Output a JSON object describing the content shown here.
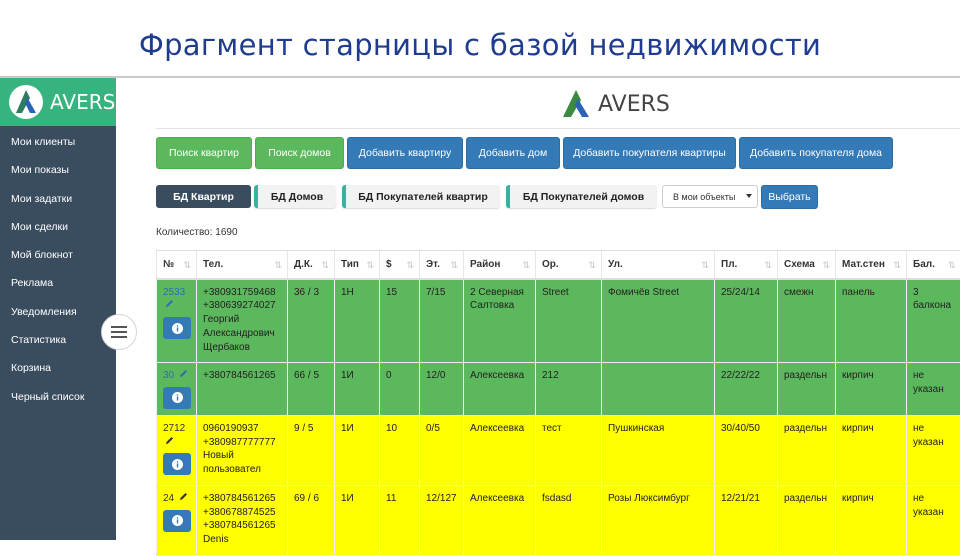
{
  "slide": {
    "title": "Фрагмент старницы с базой недвижимости"
  },
  "brand": {
    "logo_text": "AVERS"
  },
  "sidebar": {
    "items": [
      {
        "label": "Мои клиенты"
      },
      {
        "label": "Мои показы"
      },
      {
        "label": "Мои задатки"
      },
      {
        "label": "Мои сделки"
      },
      {
        "label": "Мой блокнот"
      },
      {
        "label": "Реклама"
      },
      {
        "label": "Уведомления"
      },
      {
        "label": "Статистика"
      },
      {
        "label": "Корзина"
      },
      {
        "label": "Черный список"
      }
    ]
  },
  "toolbar": {
    "buttons": [
      {
        "label": "Поиск квартир",
        "style": "green"
      },
      {
        "label": "Поиск домов",
        "style": "green"
      },
      {
        "label": "Добавить квартиру",
        "style": "blue"
      },
      {
        "label": "Добавить дом",
        "style": "blue"
      },
      {
        "label": "Добавить покупателя квартиры",
        "style": "blue"
      },
      {
        "label": "Добавить покупателя дома",
        "style": "blue"
      }
    ]
  },
  "tabs": [
    {
      "label": "БД Квартир",
      "active": true
    },
    {
      "label": "БД Домов",
      "active": false
    },
    {
      "label": "БД Покупателей квартир",
      "active": false
    },
    {
      "label": "БД Покупателей домов",
      "active": false
    }
  ],
  "filter": {
    "selected": "В мои объекты",
    "apply_label": "Выбрать"
  },
  "count_label": "Количество: 1690",
  "table": {
    "columns": [
      "№",
      "Тел.",
      "Д.К.",
      "Тип",
      "$",
      "Эт.",
      "Район",
      "Ор.",
      "Ул.",
      "Пл.",
      "Схема",
      "Мат.стен",
      "Бал."
    ],
    "rows": [
      {
        "color": "green",
        "id": "2533",
        "phones": "+380931759468 +380639274027 Георгий Александрович Щербаков",
        "dk": "36 / 3",
        "type": "1Н",
        "price": "15",
        "floor": "7/15",
        "district": "2 Северная Салтовка",
        "orient": "Street",
        "street": "Фомичёв Street",
        "area": "25/24/14",
        "scheme": "смежн",
        "walls": "панель",
        "balcony": "3 балкона"
      },
      {
        "color": "green",
        "id": "30",
        "phones": "+380784561265",
        "dk": "66 / 5",
        "type": "1И",
        "price": "0",
        "floor": "12/0",
        "district": "Алексеевка",
        "orient": "212",
        "street": "",
        "area": "22/22/22",
        "scheme": "раздельн",
        "walls": "кирпич",
        "balcony": "не указан"
      },
      {
        "color": "yellow",
        "id": "2712",
        "phones": "0960190937 +380987777777 Новый пользовател",
        "dk": "9 / 5",
        "type": "1И",
        "price": "10",
        "floor": "0/5",
        "district": "Алексеевка",
        "orient": "тест",
        "street": "Пушкинская",
        "area": "30/40/50",
        "scheme": "раздельн",
        "walls": "кирпич",
        "balcony": "не указан"
      },
      {
        "color": "yellow",
        "id": "24",
        "phones": "+380784561265 +380678874525 +380784561265 Denis",
        "dk": "69 / 6",
        "type": "1И",
        "price": "11",
        "floor": "12/127",
        "district": "Алексеевка",
        "orient": "fsdasd",
        "street": "Розы Люксимбург",
        "area": "12/21/21",
        "scheme": "раздельн",
        "walls": "кирпич",
        "balcony": "не указан"
      }
    ]
  },
  "colors": {
    "sidebar_bg": "#3a4d5f",
    "brand_green": "#36b37e",
    "row_green": "#5cb85c",
    "row_yellow": "#ffff00",
    "btn_blue": "#337ab7",
    "title_blue": "#1f3c8f"
  },
  "icons": [
    "logo-icon",
    "menu-icon",
    "pencil-icon",
    "info-icon",
    "sort-icon",
    "caret-down-icon"
  ]
}
